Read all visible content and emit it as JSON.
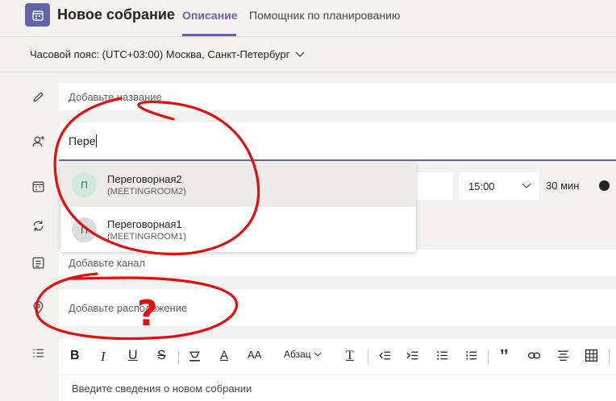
{
  "header": {
    "title": "Новое собрание",
    "tabs": [
      {
        "label": "Описание",
        "active": true
      },
      {
        "label": "Помощник по планированию",
        "active": false
      }
    ]
  },
  "timezone": {
    "label": "Часовой пояс: (UTC+03:00) Москва, Санкт-Петербург"
  },
  "form": {
    "title_placeholder": "Добавьте название",
    "attendees_value": "Пере",
    "time_value": "15:00",
    "duration": "30 мин",
    "channel_placeholder": "Добавьте канал",
    "location_placeholder": "Добавьте расположение",
    "details_placeholder": "Введите сведения о новом собрании"
  },
  "suggestions": [
    {
      "initial": "П",
      "name": "Переговорная2",
      "email": "(MEETINGROOM2)"
    },
    {
      "initial": "П",
      "name": "Переговорная1",
      "email": "(MEETINGROOM1)"
    }
  ],
  "toolbar": {
    "bold": "B",
    "italic": "I",
    "underline": "U",
    "strike": "S",
    "font_color": "A",
    "font_size": "AA",
    "paragraph": "Абзац",
    "clear_format": "T",
    "quote": "’’"
  },
  "annotation": {
    "mark": "?"
  },
  "colors": {
    "accent": "#6264a7",
    "annotation": "#e01010"
  }
}
